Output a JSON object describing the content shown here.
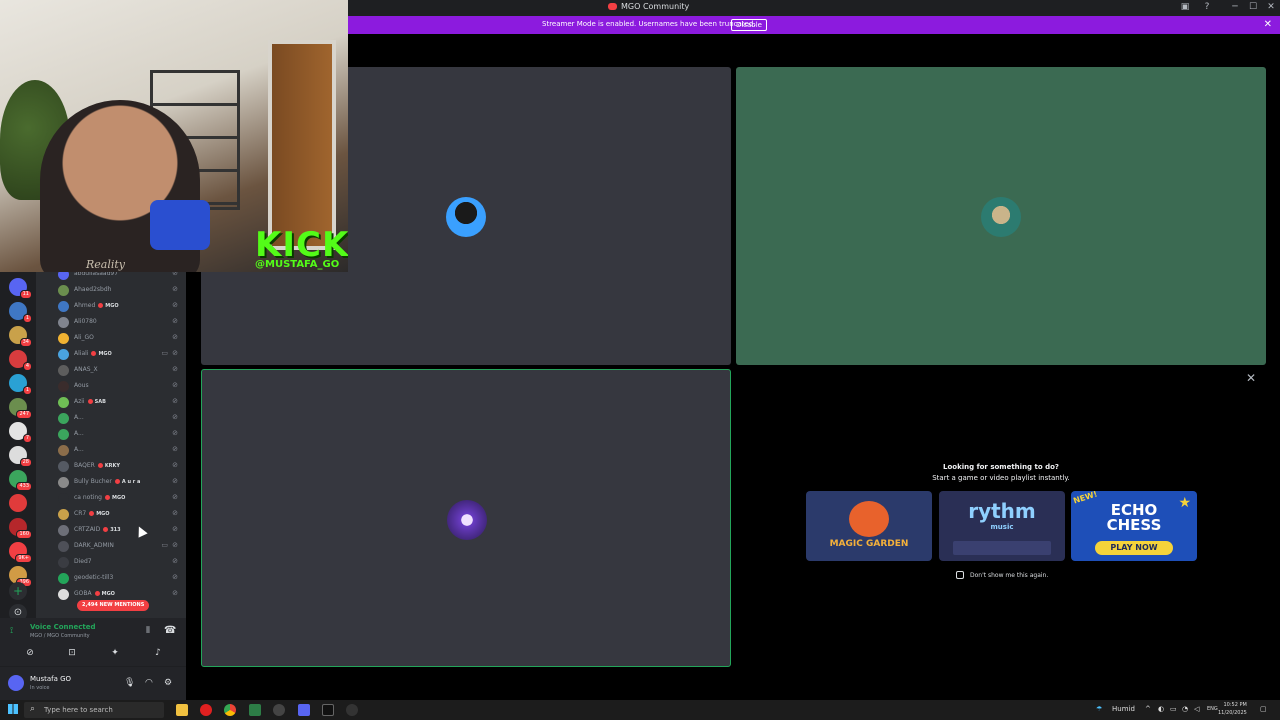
{
  "window": {
    "title": "MGO Community",
    "minimize": "─",
    "maximize": "☐",
    "close": "✕"
  },
  "banner": {
    "message": "Streamer Mode is enabled. Usernames have been truncated.",
    "disable_label": "Disable",
    "close": "✕"
  },
  "overlay": {
    "kick_logo": "KICK",
    "kick_handle": "@MUSTAFA_GO",
    "watermark": "Reality"
  },
  "servers": [
    {
      "color": "#5865f2",
      "badge": "11"
    },
    {
      "color": "#3f77c4",
      "badge": "1"
    },
    {
      "color": "#c9a14a",
      "badge": "34"
    },
    {
      "color": "#d83c3e",
      "badge": "4"
    },
    {
      "color": "#2aa1d4",
      "badge": "1"
    },
    {
      "color": "#6b8e4e",
      "badge": "247"
    },
    {
      "color": "#e4e4e4",
      "badge": "7"
    },
    {
      "color": "#dddddd",
      "badge": "28"
    },
    {
      "color": "#3ba55d",
      "badge": "433"
    },
    {
      "color": "#e03b3b",
      "badge": ""
    },
    {
      "color": "#b5272b",
      "badge": "160"
    },
    {
      "color": "#f23f43",
      "badge": "9K+"
    },
    {
      "color": "#d19b45",
      "badge": "396"
    }
  ],
  "members": [
    {
      "name": "abdullasaad97",
      "tag": "",
      "avatar": "#5865f2",
      "cam": false
    },
    {
      "name": "Ahaed2sbdh",
      "tag": "",
      "avatar": "#6b8e4e",
      "cam": false
    },
    {
      "name": "Ahmed",
      "tag": "MGO",
      "avatar": "#3f77c4",
      "cam": false
    },
    {
      "name": "Ali0780",
      "tag": "",
      "avatar": "#80848e",
      "cam": false
    },
    {
      "name": "Ali_GO",
      "tag": "",
      "avatar": "#f0b232",
      "cam": false
    },
    {
      "name": "Aliali",
      "tag": "MGO",
      "avatar": "#4aa3df",
      "cam": true
    },
    {
      "name": "ANAS_X",
      "tag": "",
      "avatar": "#5d5d5d",
      "cam": false
    },
    {
      "name": "Aous",
      "tag": "",
      "avatar": "#3a2c2c",
      "cam": false
    },
    {
      "name": "Azii",
      "tag": "SAB",
      "avatar": "#6fbf55",
      "cam": false
    },
    {
      "name": "A...",
      "tag": "",
      "avatar": "#3ba55d",
      "cam": false
    },
    {
      "name": "A...",
      "tag": "",
      "avatar": "#3ba55d",
      "cam": false
    },
    {
      "name": "A...",
      "tag": "",
      "avatar": "#8b6d4a",
      "cam": false
    },
    {
      "name": "BAQER",
      "tag": "KRKY",
      "avatar": "#555a63",
      "cam": false
    },
    {
      "name": "Bully Bucher",
      "tag": "A u r a",
      "avatar": "#8a8a8a",
      "cam": false
    },
    {
      "name": "ca noting",
      "tag": "MGO",
      "avatar": "#2b2d31",
      "cam": false
    },
    {
      "name": "CR7",
      "tag": "MGO",
      "avatar": "#c9a14a",
      "cam": false
    },
    {
      "name": "CRTZAID",
      "tag": "313",
      "avatar": "#6d6f78",
      "cam": false
    },
    {
      "name": "DARK_ADMIN",
      "tag": "",
      "avatar": "#4e5058",
      "cam": true
    },
    {
      "name": "Died7",
      "tag": "",
      "avatar": "#3a3c42",
      "cam": false
    },
    {
      "name": "geodetic-till3",
      "tag": "",
      "avatar": "#23a55a",
      "cam": false
    },
    {
      "name": "GOBA",
      "tag": "MGO",
      "avatar": "#dddddd",
      "cam": false
    }
  ],
  "mentions_pill": "2,494 NEW MENTIONS",
  "voice": {
    "status": "Voice Connected",
    "channel": "MGO / MGO Community"
  },
  "user": {
    "name": "Mustafa GO",
    "status": "In voice"
  },
  "activity": {
    "heading": "Looking for something to do?",
    "subheading": "Start a game or video playlist instantly.",
    "cards": [
      {
        "label": "MAGIC GARDEN",
        "bg": "#2b3a6b",
        "accent": "#e8622c"
      },
      {
        "label": "rythm",
        "sub": "music",
        "bg": "#2a2f55",
        "accent": "#6fb6ff"
      },
      {
        "label": "ECHO CHESS",
        "badge": "NEW!",
        "cta": "PLAY NOW",
        "bg": "#1e4fb8",
        "accent": "#f5d33a"
      }
    ],
    "dont_show": "Don't show me this again."
  },
  "taskbar": {
    "search_placeholder": "Type here to search",
    "weather": "Humid",
    "language": "ENG",
    "time": "10:52 PM",
    "date": "11/20/2025"
  }
}
